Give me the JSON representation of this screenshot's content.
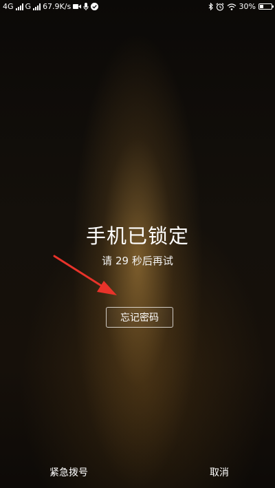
{
  "status_bar": {
    "network_1": "4G",
    "network_2": "G",
    "speed": "67.9K/s",
    "battery_text": "30%",
    "battery_level": 0.3
  },
  "lock": {
    "title": "手机已锁定",
    "retry_prefix": "请 ",
    "retry_seconds": "29",
    "retry_suffix": " 秒后再试",
    "forgot_password": "忘记密码"
  },
  "actions": {
    "emergency_call": "紧急拨号",
    "cancel": "取消"
  },
  "colors": {
    "annotation_arrow": "#e8332a",
    "glow": "#c89646"
  },
  "icons": [
    "video-camera-icon",
    "microphone-icon",
    "check-circle-icon",
    "bluetooth-icon",
    "alarm-clock-icon",
    "wifi-icon",
    "battery-icon"
  ]
}
